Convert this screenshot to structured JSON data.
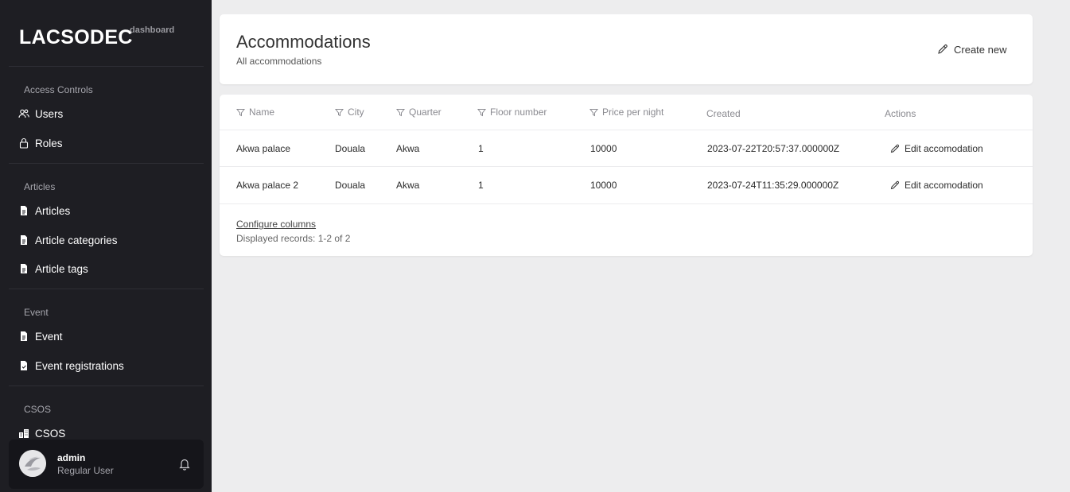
{
  "brand": {
    "name": "LACSODEC",
    "subtitle": "dashboard"
  },
  "sidebar": {
    "sections": [
      {
        "title": "Access Controls",
        "items": [
          {
            "label": "Users",
            "icon": "users-icon"
          },
          {
            "label": "Roles",
            "icon": "lock-icon"
          }
        ]
      },
      {
        "title": "Articles",
        "items": [
          {
            "label": "Articles",
            "icon": "document-icon"
          },
          {
            "label": "Article categories",
            "icon": "document-icon"
          },
          {
            "label": "Article tags",
            "icon": "document-icon"
          }
        ]
      },
      {
        "title": "Event",
        "items": [
          {
            "label": "Event",
            "icon": "document-icon"
          },
          {
            "label": "Event registrations",
            "icon": "document-check-icon"
          }
        ]
      },
      {
        "title": "CSOS",
        "items": [
          {
            "label": "CSOS",
            "icon": "buildings-icon"
          }
        ]
      }
    ]
  },
  "user": {
    "name": "admin",
    "role": "Regular User"
  },
  "header": {
    "title": "Accommodations",
    "subtitle": "All accommodations",
    "create_label": "Create new"
  },
  "table": {
    "columns": [
      {
        "label": "Name",
        "filterable": true
      },
      {
        "label": "City",
        "filterable": true
      },
      {
        "label": "Quarter",
        "filterable": true
      },
      {
        "label": "Floor number",
        "filterable": true
      },
      {
        "label": "Price per night",
        "filterable": true
      },
      {
        "label": "Created",
        "filterable": false
      },
      {
        "label": "Actions",
        "filterable": false
      }
    ],
    "rows": [
      {
        "name": "Akwa palace",
        "city": "Douala",
        "quarter": "Akwa",
        "floor": "1",
        "price": "10000",
        "created": "2023-07-22T20:57:37.000000Z",
        "action": "Edit accomodation"
      },
      {
        "name": "Akwa palace 2",
        "city": "Douala",
        "quarter": "Akwa",
        "floor": "1",
        "price": "10000",
        "created": "2023-07-24T11:35:29.000000Z",
        "action": "Edit accomodation"
      }
    ],
    "configure_label": "Configure columns",
    "records_label": "Displayed records: 1-2 of 2"
  },
  "colors": {
    "sidebar_bg": "#1e1e23",
    "page_bg": "#ededee",
    "card_bg": "#ffffff"
  }
}
